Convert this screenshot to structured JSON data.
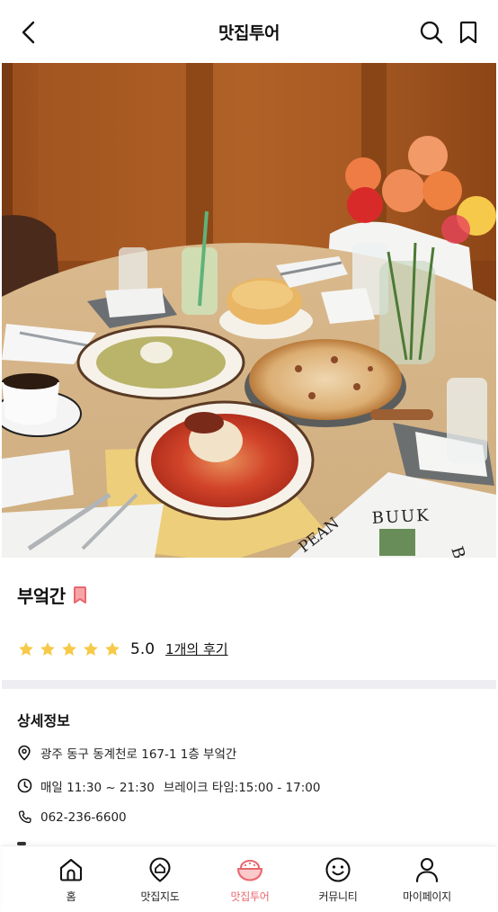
{
  "header": {
    "title": "맛집투어",
    "back_icon": "chevron-left-icon",
    "search_icon": "search-icon",
    "bookmark_icon": "bookmark-icon"
  },
  "restaurant": {
    "name": "부엌간",
    "bookmarked": true,
    "bookmark_color": "#e8686e",
    "rating": "5.0",
    "stars_filled": 5,
    "star_color": "#f7c948",
    "review_link": "1개의 후기"
  },
  "details": {
    "title": "상세정보",
    "address": "광주 동구 동계천로 167-1 1층 부엌간",
    "hours": "매일 11:30 ~ 21:30",
    "break_time": "브레이크 타임:15:00 - 17:00",
    "phone": "062-236-6600"
  },
  "photo": {
    "newspaper_headline": "BUUK",
    "newspaper_left": "PEAN",
    "newspaper_right": "BS"
  },
  "tabbar": {
    "accent": "#e8686e",
    "items": [
      {
        "label": "홈",
        "icon": "home-icon"
      },
      {
        "label": "맛집지도",
        "icon": "map-pin-icon"
      },
      {
        "label": "맛집투어",
        "icon": "rice-bowl-icon",
        "active": true
      },
      {
        "label": "커뮤니티",
        "icon": "smile-icon"
      },
      {
        "label": "마이페이지",
        "icon": "user-icon"
      }
    ]
  }
}
